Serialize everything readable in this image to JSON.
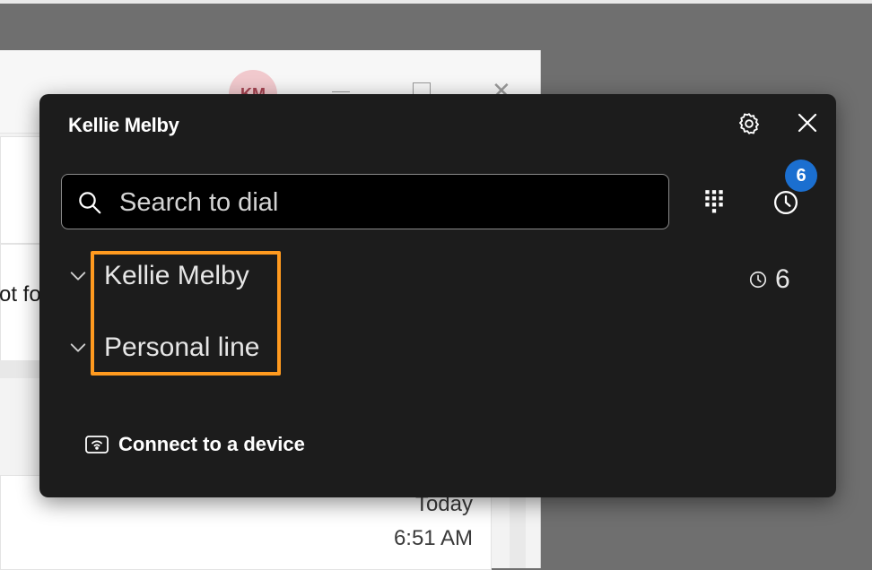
{
  "background_window": {
    "avatar_initials": "KM",
    "partial_text": "ot fo",
    "timestamp_day": "Today",
    "timestamp_time": "6:51 AM"
  },
  "dialer_panel": {
    "title": "Kellie Melby",
    "search": {
      "placeholder": "Search to dial",
      "value": ""
    },
    "history_badge_count": "6",
    "lines": [
      {
        "label": "Kellie Melby",
        "recent_calls_count": "6"
      },
      {
        "label": "Personal line"
      }
    ],
    "connect_device_label": "Connect to a device"
  },
  "icons": {
    "settings": "gear-icon",
    "close": "close-icon",
    "search": "search-icon",
    "dialpad": "dialpad-icon",
    "history": "clock-icon",
    "expand": "chevron-down-icon",
    "device": "device-icon"
  },
  "colors": {
    "panel_background": "#1c1c1c",
    "badge": "#1b6fd0",
    "highlight_outline": "#ff9a1f",
    "avatar_background": "#f1c9cd"
  }
}
